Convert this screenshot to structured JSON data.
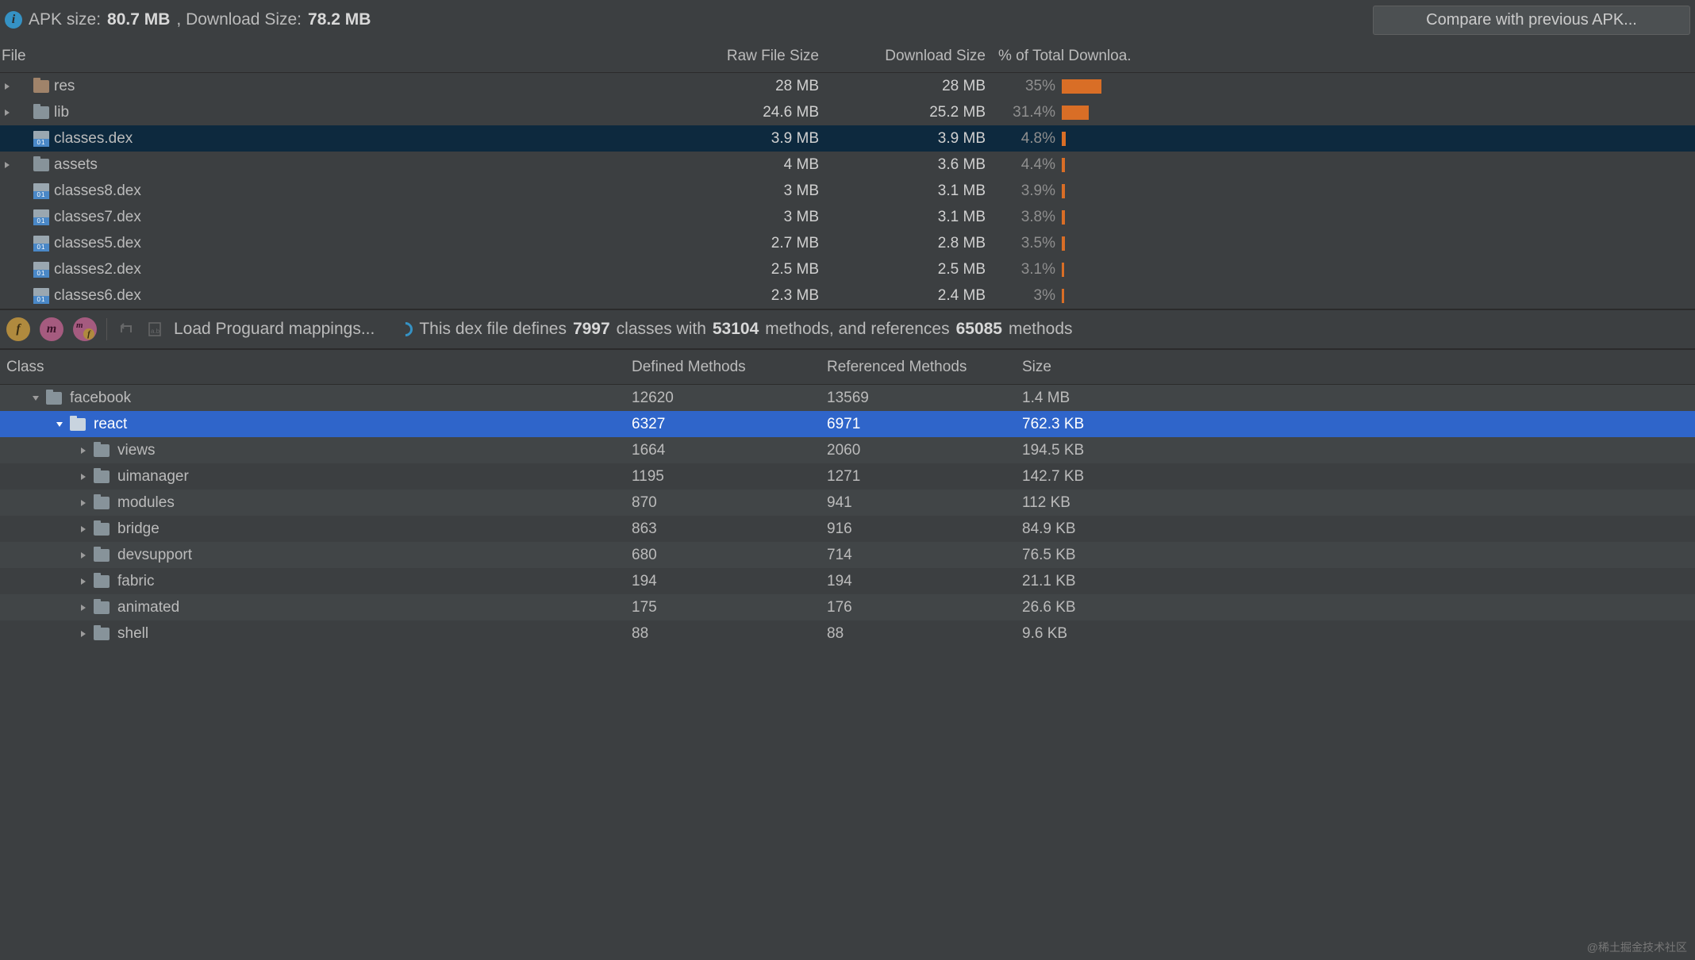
{
  "top": {
    "apk_size_label": "APK size:",
    "apk_size_value": "80.7 MB",
    "download_size_label": ", Download Size:",
    "download_size_value": "78.2 MB",
    "compare_button": "Compare with previous APK..."
  },
  "file_table": {
    "headers": {
      "file": "File",
      "raw": "Raw File Size",
      "download": "Download Size",
      "pct": "% of Total Downloa.."
    },
    "rows": [
      {
        "name": "res",
        "icon": "res",
        "expandable": true,
        "raw": "28 MB",
        "dl": "28 MB",
        "pct": "35%",
        "bar": 50
      },
      {
        "name": "lib",
        "icon": "folder",
        "expandable": true,
        "raw": "24.6 MB",
        "dl": "25.2 MB",
        "pct": "31.4%",
        "bar": 34
      },
      {
        "name": "classes.dex",
        "icon": "dex",
        "expandable": false,
        "raw": "3.9 MB",
        "dl": "3.9 MB",
        "pct": "4.8%",
        "bar": 5,
        "selected": true
      },
      {
        "name": "assets",
        "icon": "folder",
        "expandable": true,
        "raw": "4 MB",
        "dl": "3.6 MB",
        "pct": "4.4%",
        "bar": 4
      },
      {
        "name": "classes8.dex",
        "icon": "dex",
        "expandable": false,
        "raw": "3 MB",
        "dl": "3.1 MB",
        "pct": "3.9%",
        "bar": 4
      },
      {
        "name": "classes7.dex",
        "icon": "dex",
        "expandable": false,
        "raw": "3 MB",
        "dl": "3.1 MB",
        "pct": "3.8%",
        "bar": 4
      },
      {
        "name": "classes5.dex",
        "icon": "dex",
        "expandable": false,
        "raw": "2.7 MB",
        "dl": "2.8 MB",
        "pct": "3.5%",
        "bar": 4
      },
      {
        "name": "classes2.dex",
        "icon": "dex",
        "expandable": false,
        "raw": "2.5 MB",
        "dl": "2.5 MB",
        "pct": "3.1%",
        "bar": 3
      },
      {
        "name": "classes6.dex",
        "icon": "dex",
        "expandable": false,
        "raw": "2.3 MB",
        "dl": "2.4 MB",
        "pct": "3%",
        "bar": 3
      }
    ]
  },
  "toolbar": {
    "load_proguard": "Load Proguard mappings...",
    "dex_info_prefix": "This dex file defines",
    "classes_count": "7997",
    "classes_word": "classes with",
    "methods_count": "53104",
    "methods_word": "methods, and references",
    "ref_methods_count": "65085",
    "methods_suffix": "methods"
  },
  "class_table": {
    "headers": {
      "class": "Class",
      "defined": "Defined Methods",
      "referenced": "Referenced Methods",
      "size": "Size"
    },
    "rows": [
      {
        "name": "facebook",
        "indent": 1,
        "expanded": true,
        "defined": "12620",
        "referenced": "13569",
        "size": "1.4 MB",
        "alt": true
      },
      {
        "name": "react",
        "indent": 2,
        "expanded": true,
        "defined": "6327",
        "referenced": "6971",
        "size": "762.3 KB",
        "selected": true
      },
      {
        "name": "views",
        "indent": 3,
        "expanded": false,
        "defined": "1664",
        "referenced": "2060",
        "size": "194.5 KB",
        "alt": true
      },
      {
        "name": "uimanager",
        "indent": 3,
        "expanded": false,
        "defined": "1195",
        "referenced": "1271",
        "size": "142.7 KB"
      },
      {
        "name": "modules",
        "indent": 3,
        "expanded": false,
        "defined": "870",
        "referenced": "941",
        "size": "112 KB",
        "alt": true
      },
      {
        "name": "bridge",
        "indent": 3,
        "expanded": false,
        "defined": "863",
        "referenced": "916",
        "size": "84.9 KB"
      },
      {
        "name": "devsupport",
        "indent": 3,
        "expanded": false,
        "defined": "680",
        "referenced": "714",
        "size": "76.5 KB",
        "alt": true
      },
      {
        "name": "fabric",
        "indent": 3,
        "expanded": false,
        "defined": "194",
        "referenced": "194",
        "size": "21.1 KB"
      },
      {
        "name": "animated",
        "indent": 3,
        "expanded": false,
        "defined": "175",
        "referenced": "176",
        "size": "26.6 KB",
        "alt": true
      },
      {
        "name": "shell",
        "indent": 3,
        "expanded": false,
        "defined": "88",
        "referenced": "88",
        "size": "9.6 KB"
      }
    ]
  },
  "watermark": "@稀土掘金技术社区"
}
